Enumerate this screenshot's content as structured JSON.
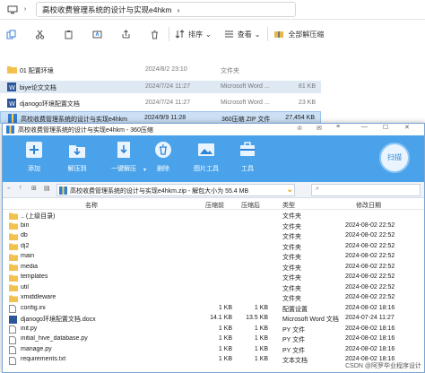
{
  "explorer": {
    "path": "高校收费管理系统的设计与实现e4hkm",
    "toolbar": {
      "sort": "排序",
      "view": "查看",
      "extract_all": "全部解压缩"
    },
    "files": [
      {
        "name": "01 配置环境",
        "date": "2024/8/2 23:10",
        "type": "文件夹",
        "size": ""
      },
      {
        "name": "biye论文文档",
        "date": "2024/7/24 11:27",
        "type": "Microsoft Word ...",
        "size": "81 KB"
      },
      {
        "name": "djanogo环境配置文档",
        "date": "2024/7/24 11:27",
        "type": "Microsoft Word ...",
        "size": "23 KB"
      },
      {
        "name": "高校收费管理系统的设计与实现e4hkm",
        "date": "2024/9/9 11:28",
        "type": "360压缩 ZIP 文件",
        "size": "27,454 KB"
      }
    ]
  },
  "archive": {
    "title": "高校收费管理系统的设计与实现e4hkm - 360压缩",
    "buttons": {
      "add": "添加",
      "extract_to": "解压到",
      "one_click": "一键解压",
      "delete": "删除",
      "image_tool": "图片工具",
      "tools": "工具",
      "scan": "扫描"
    },
    "path": "高校收费管理系统的设计与实现e4hkm.zip - 解包大小为 55.4 MB",
    "headers": {
      "name": "名称",
      "compressed": "压缩前",
      "original": "压缩后",
      "type": "类型",
      "modified": "修改日期"
    },
    "rows": [
      {
        "name": ".. (上级目录)",
        "c": "",
        "o": "",
        "type": "文件夹",
        "date": ""
      },
      {
        "name": "bin",
        "c": "",
        "o": "",
        "type": "文件夹",
        "date": "2024-08-02 22:52"
      },
      {
        "name": "db",
        "c": "",
        "o": "",
        "type": "文件夹",
        "date": "2024-08-02 22:52"
      },
      {
        "name": "dj2",
        "c": "",
        "o": "",
        "type": "文件夹",
        "date": "2024-08-02 22:52"
      },
      {
        "name": "main",
        "c": "",
        "o": "",
        "type": "文件夹",
        "date": "2024-08-02 22:52"
      },
      {
        "name": "media",
        "c": "",
        "o": "",
        "type": "文件夹",
        "date": "2024-08-02 22:52"
      },
      {
        "name": "templates",
        "c": "",
        "o": "",
        "type": "文件夹",
        "date": "2024-08-02 22:52"
      },
      {
        "name": "util",
        "c": "",
        "o": "",
        "type": "文件夹",
        "date": "2024-08-02 22:52"
      },
      {
        "name": "xmiddleware",
        "c": "",
        "o": "",
        "type": "文件夹",
        "date": "2024-08-02 22:52"
      },
      {
        "name": "config.ini",
        "c": "1 KB",
        "o": "1 KB",
        "type": "配置设置",
        "date": "2024-08-02 18:16"
      },
      {
        "name": "djanogo环境配置文档.docx",
        "c": "14.1 KB",
        "o": "13.5 KB",
        "type": "Microsoft Word 文档",
        "date": "2024-07-24 11:27"
      },
      {
        "name": "init.py",
        "c": "1 KB",
        "o": "1 KB",
        "type": "PY 文件",
        "date": "2024-08-02 18:16"
      },
      {
        "name": "initial_hive_database.py",
        "c": "1 KB",
        "o": "1 KB",
        "type": "PY 文件",
        "date": "2024-08-02 18:16"
      },
      {
        "name": "manage.py",
        "c": "1 KB",
        "o": "1 KB",
        "type": "PY 文件",
        "date": "2024-08-02 18:16"
      },
      {
        "name": "requirements.txt",
        "c": "1 KB",
        "o": "1 KB",
        "type": "文本文档",
        "date": "2024-08-02 18:16"
      }
    ],
    "watermark": "CSDN @阿罗毕业程序设计"
  }
}
